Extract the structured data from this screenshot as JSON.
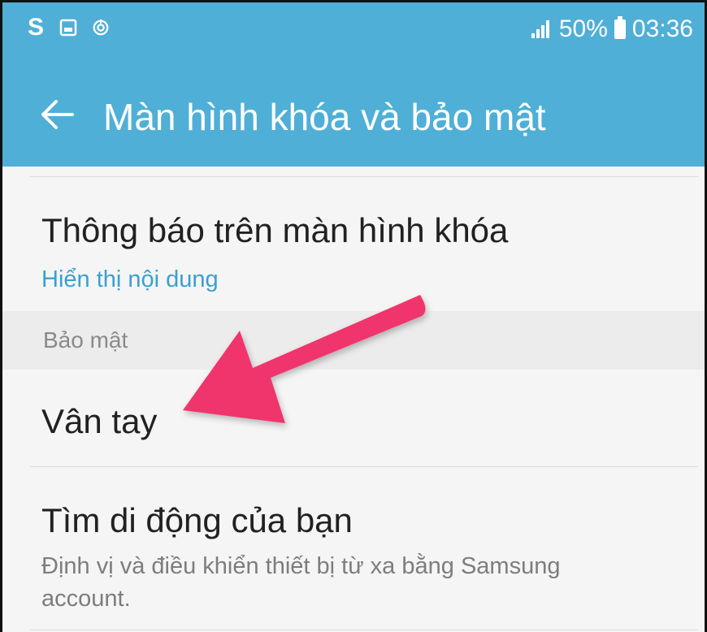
{
  "status_bar": {
    "left_icons": [
      "samsung-s-icon",
      "image-icon",
      "sync-icon"
    ],
    "battery": "50%",
    "time": "03:36"
  },
  "toolbar": {
    "title": "Màn hình khóa và bảo mật",
    "back_icon": "arrow-left-icon"
  },
  "list": {
    "lock_notifications": {
      "title": "Thông báo trên màn hình khóa",
      "subtitle": "Hiển thị nội dung"
    },
    "section_security": "Bảo mật",
    "fingerprint": {
      "title": "Vân tay"
    },
    "find_my_mobile": {
      "title": "Tìm di động của bạn",
      "subtitle_line1": "Định vị và điều khiển thiết bị từ xa bằng Samsung",
      "subtitle_line2": "account."
    }
  },
  "colors": {
    "appbar": "#4fafd6",
    "accent_text": "#3aa0cf",
    "annotation_arrow": "#f0366c"
  }
}
